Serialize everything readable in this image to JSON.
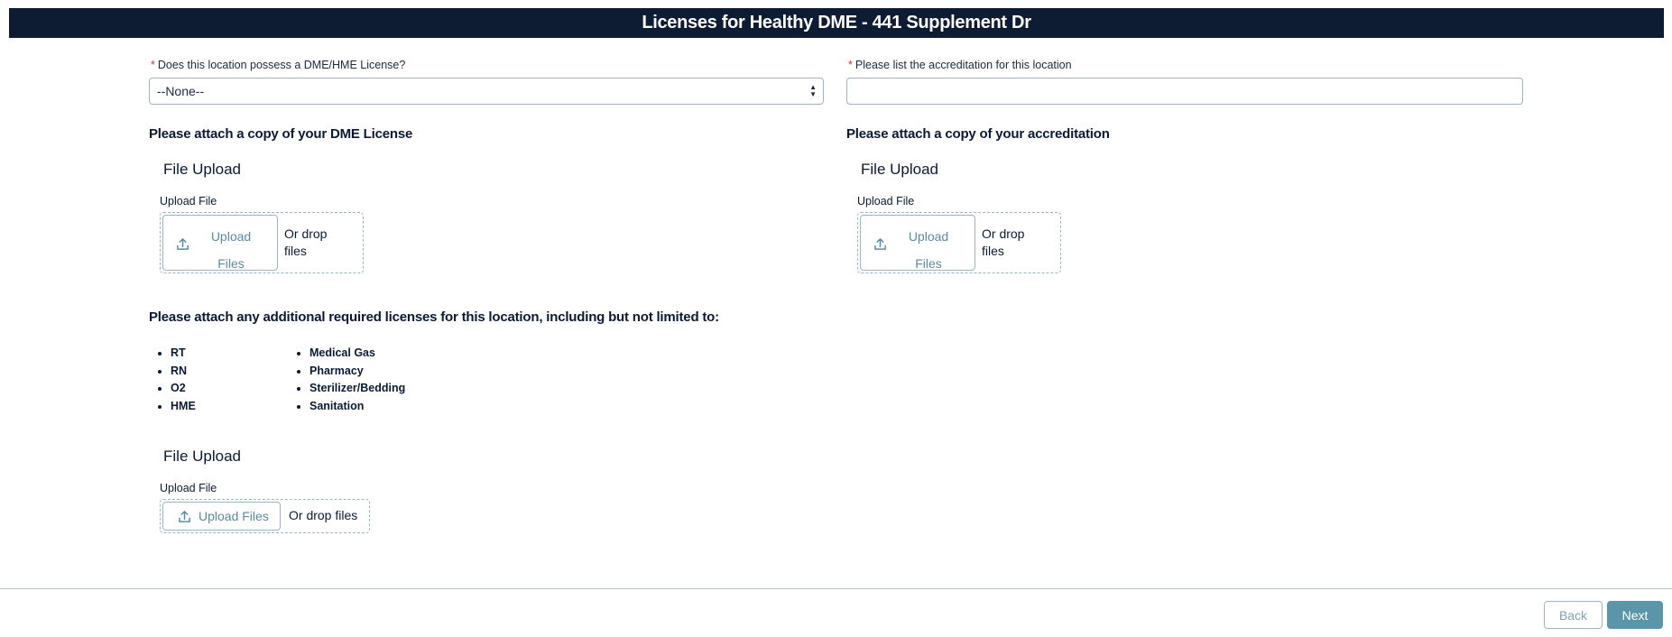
{
  "header": {
    "title": "Licenses for Healthy DME - 441 Supplement Dr"
  },
  "license_question": {
    "required_mark": "*",
    "label": "Does this location possess a DME/HME License?",
    "selected_value": "--None--"
  },
  "accreditation_question": {
    "required_mark": "*",
    "label": "Please list the accreditation for this location",
    "value": ""
  },
  "dme_license_upload": {
    "section_title": "Please attach a copy of your DME License",
    "title": "File Upload",
    "label": "Upload File",
    "button_line1": "Upload",
    "button_line2": "Files",
    "drop_line1": "Or drop",
    "drop_line2": "files"
  },
  "accreditation_upload": {
    "section_title": "Please attach a copy of your accreditation",
    "title": "File Upload",
    "label": "Upload File",
    "button_line1": "Upload",
    "button_line2": "Files",
    "drop_line1": "Or drop",
    "drop_line2": "files"
  },
  "additional_licenses": {
    "section_title": "Please attach any additional required licenses for this location, including but not limited to:",
    "list_col1": [
      "RT",
      "RN",
      "O2",
      "HME"
    ],
    "list_col2": [
      "Medical Gas",
      "Pharmacy",
      "Sterilizer/Bedding",
      "Sanitation"
    ],
    "title": "File Upload",
    "label": "Upload File",
    "button_label": "Upload Files",
    "drop_text": "Or drop files"
  },
  "footer": {
    "back_label": "Back",
    "next_label": "Next"
  },
  "colors": {
    "header_bg": "#0d1b33",
    "accent": "#5b95aa",
    "required": "#c23934"
  },
  "icons": {
    "upload": "upload-icon",
    "select": "select-arrows-icon"
  }
}
